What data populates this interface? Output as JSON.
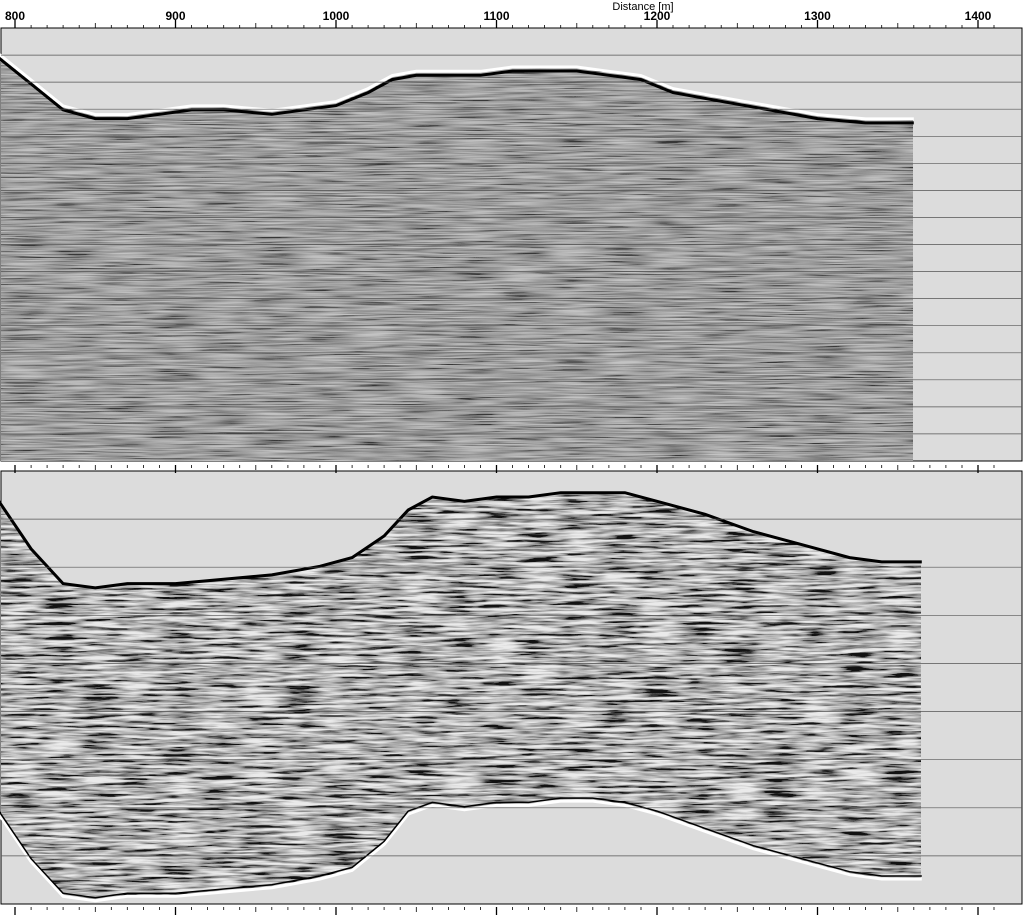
{
  "chart_data": [
    {
      "type": "radargram",
      "panel": "top",
      "xlabel": "Distance [m]",
      "x_range": [
        790,
        1410
      ],
      "data_extent": [
        790,
        1360
      ],
      "major_ticks": [
        800,
        900,
        1000,
        1100,
        1200,
        1300,
        1400
      ],
      "tick_labels": [
        "800",
        "900",
        "1000",
        "1100",
        "1200",
        "1300",
        "1400"
      ],
      "minor_tick_step": 10,
      "grid": true,
      "horizontal_gridline_count": 15,
      "surface_profile": {
        "distance": [
          790,
          810,
          830,
          850,
          870,
          890,
          910,
          930,
          960,
          1000,
          1020,
          1035,
          1050,
          1070,
          1090,
          1110,
          1130,
          1150,
          1170,
          1190,
          1210,
          1240,
          1270,
          1300,
          1330,
          1360
        ],
        "level": [
          0.94,
          0.88,
          0.82,
          0.8,
          0.8,
          0.81,
          0.82,
          0.82,
          0.81,
          0.83,
          0.86,
          0.89,
          0.9,
          0.9,
          0.9,
          0.91,
          0.91,
          0.91,
          0.9,
          0.89,
          0.86,
          0.84,
          0.82,
          0.8,
          0.79,
          0.79
        ]
      }
    },
    {
      "type": "radargram",
      "panel": "bottom",
      "x_range": [
        790,
        1410
      ],
      "data_extent": [
        790,
        1365
      ],
      "minor_tick_step": 10,
      "grid": true,
      "horizontal_gridline_count": 8,
      "surface_profile": {
        "distance": [
          790,
          810,
          830,
          850,
          870,
          900,
          930,
          960,
          990,
          1010,
          1030,
          1045,
          1060,
          1080,
          1100,
          1120,
          1140,
          1160,
          1180,
          1200,
          1230,
          1260,
          1290,
          1320,
          1340,
          1365
        ],
        "level": [
          0.93,
          0.82,
          0.74,
          0.73,
          0.74,
          0.74,
          0.75,
          0.76,
          0.78,
          0.8,
          0.85,
          0.91,
          0.94,
          0.93,
          0.94,
          0.94,
          0.95,
          0.95,
          0.95,
          0.93,
          0.9,
          0.86,
          0.83,
          0.8,
          0.79,
          0.79
        ]
      },
      "base_profile": {
        "distance": [
          790,
          810,
          830,
          850,
          870,
          900,
          930,
          960,
          990,
          1010,
          1030,
          1045,
          1060,
          1080,
          1100,
          1120,
          1140,
          1160,
          1180,
          1200,
          1230,
          1260,
          1290,
          1320,
          1340,
          1365
        ],
        "level": [
          0.21,
          0.1,
          0.02,
          0.01,
          0.02,
          0.02,
          0.03,
          0.04,
          0.06,
          0.08,
          0.14,
          0.21,
          0.23,
          0.22,
          0.23,
          0.23,
          0.24,
          0.24,
          0.23,
          0.21,
          0.17,
          0.13,
          0.1,
          0.07,
          0.06,
          0.06
        ]
      }
    }
  ],
  "colors": {
    "page_background": "#ffffff",
    "panel_background": "#dcdcdc",
    "radargram_base": "#7a7a7a",
    "reflector_dark": "#000000",
    "reflector_light": "#ffffff",
    "gridline": "#555555"
  }
}
